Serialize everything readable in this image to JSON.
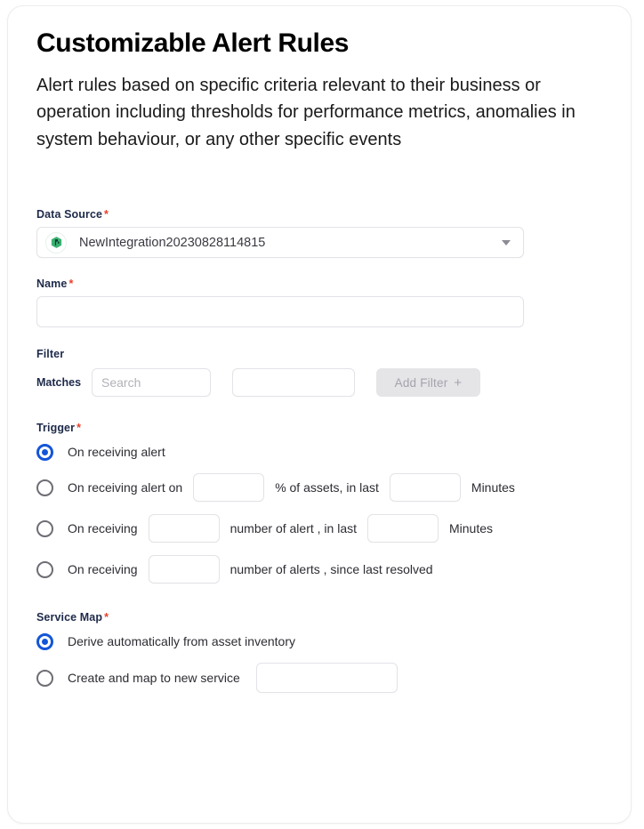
{
  "header": {
    "title": "Customizable Alert Rules",
    "description": "Alert rules based on specific criteria relevant to their business or operation including thresholds for performance metrics, anomalies in system behaviour, or any other specific events"
  },
  "form": {
    "data_source": {
      "label": "Data Source",
      "required_marker": "*",
      "icon": "integration-logo-icon",
      "value": "NewIntegration20230828114815",
      "caret_icon": "chevron-down-icon"
    },
    "name": {
      "label": "Name",
      "required_marker": "*",
      "value": "",
      "placeholder": ""
    },
    "filter": {
      "label": "Filter",
      "matches_label": "Matches",
      "search_value": "",
      "search_placeholder": "Search",
      "second_value": "",
      "second_placeholder": "",
      "add_button_label": "Add Filter",
      "add_button_plus": "+",
      "add_button_disabled": true
    },
    "trigger": {
      "label": "Trigger",
      "required_marker": "*",
      "selected_index": 0,
      "options": [
        {
          "label": "On receiving alert",
          "selected": true,
          "inputs": [],
          "texts": []
        },
        {
          "label": "On receiving alert on",
          "selected": false,
          "input1_value": "",
          "mid_text": "% of assets, in last",
          "input2_value": "",
          "end_text": "Minutes"
        },
        {
          "label": "On receiving",
          "selected": false,
          "input1_value": "",
          "mid_text": "number of alert , in last",
          "input2_value": "",
          "end_text": "Minutes"
        },
        {
          "label": "On receiving",
          "selected": false,
          "input1_value": "",
          "mid_text": "number of alerts , since last resolved"
        }
      ]
    },
    "service_map": {
      "label": "Service Map",
      "required_marker": "*",
      "selected_index": 0,
      "options": [
        {
          "label": "Derive automatically from asset inventory",
          "selected": true
        },
        {
          "label": "Create and map to new service",
          "selected": false,
          "input_value": "",
          "input_placeholder": ""
        }
      ]
    }
  },
  "colors": {
    "accent_blue": "#1355d8",
    "required_red": "#e8402a",
    "label_navy": "#1e2a4a",
    "border_gray": "#e3e3e8",
    "disabled_bg": "#e5e5e8",
    "disabled_text": "#a3a3ab",
    "icon_green": "#2fa35f"
  }
}
